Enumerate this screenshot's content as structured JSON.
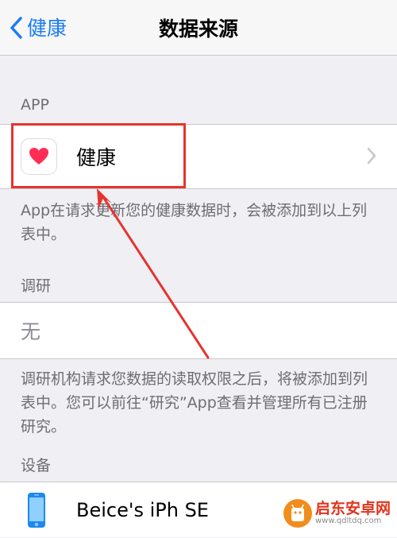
{
  "nav": {
    "back_label": "健康",
    "title": "数据来源"
  },
  "sections": {
    "apps": {
      "header": "APP",
      "rows": [
        {
          "label": "健康",
          "icon": "health-heart-icon"
        }
      ],
      "footer": "App在请求更新您的健康数据时，会被添加到以上列表中。"
    },
    "research": {
      "header": "调研",
      "empty_label": "无",
      "footer": "调研机构请求您数据的读取权限之后，将被添加到列表中。您可以前往“研究”App查看并管理所有已注册研究。"
    },
    "devices": {
      "header": "设备",
      "rows": [
        {
          "label": "Beice's iPh SE",
          "icon": "iphone-icon"
        }
      ]
    }
  },
  "watermark": {
    "title": "启东安卓网",
    "url": "www.qdltdq.com"
  },
  "colors": {
    "accent": "#1a7cf5",
    "annotation": "#e5342e",
    "background": "#efeff4",
    "secondary_text": "#6d6d72"
  }
}
